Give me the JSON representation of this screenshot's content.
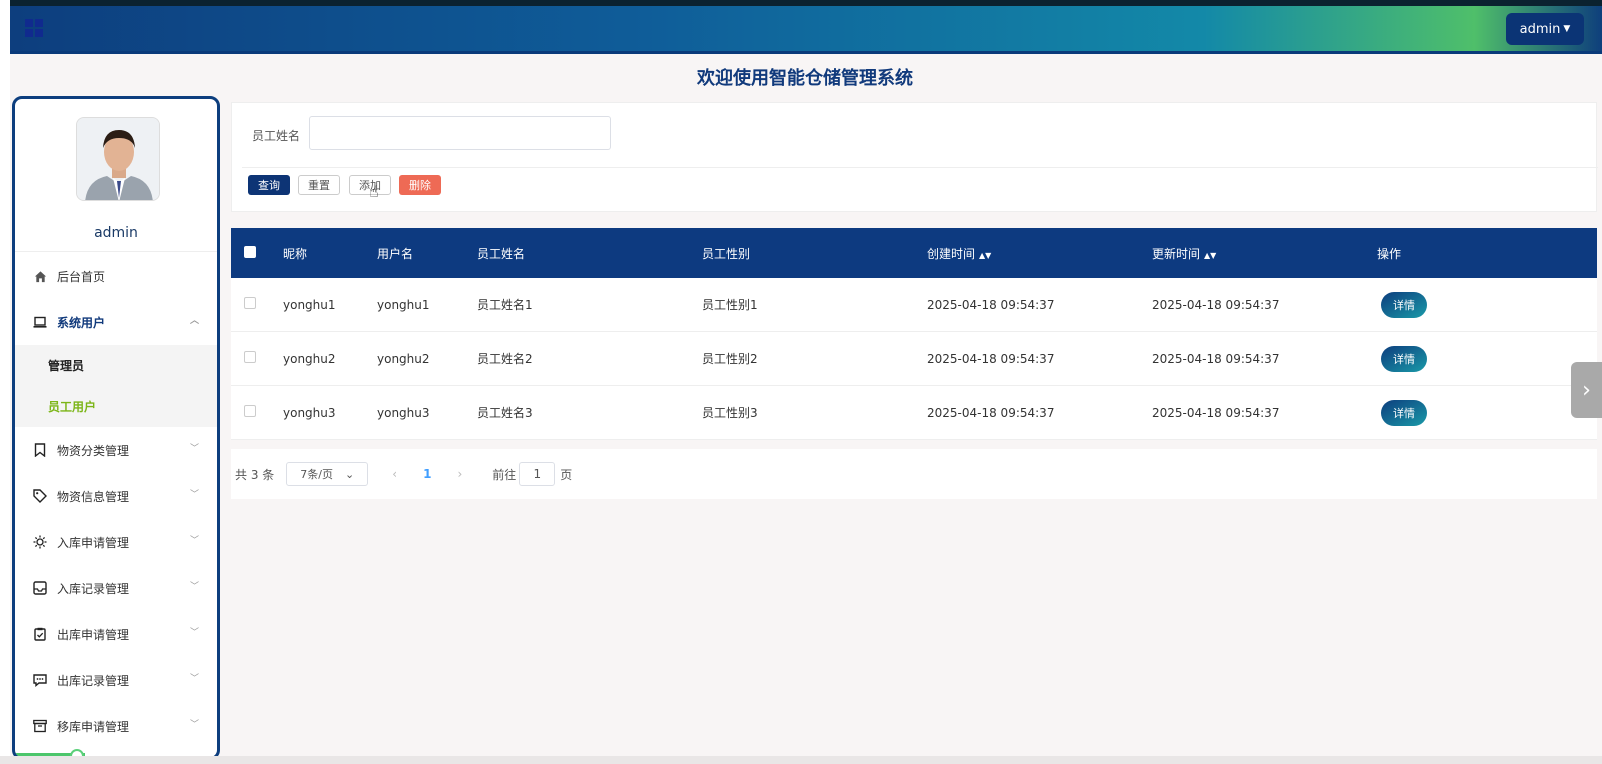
{
  "header": {
    "user_menu": "admin",
    "title": "欢迎使用智能仓储管理系统"
  },
  "sidebar": {
    "username": "admin",
    "items": [
      {
        "label": "后台首页",
        "icon": "home-icon"
      },
      {
        "label": "系统用户",
        "icon": "laptop-icon",
        "open": true,
        "children": [
          {
            "label": "管理员"
          },
          {
            "label": "员工用户",
            "active": true
          }
        ]
      },
      {
        "label": "物资分类管理",
        "icon": "bookmark-icon"
      },
      {
        "label": "物资信息管理",
        "icon": "tag-icon"
      },
      {
        "label": "入库申请管理",
        "icon": "sun-icon"
      },
      {
        "label": "入库记录管理",
        "icon": "inbox-icon"
      },
      {
        "label": "出库申请管理",
        "icon": "clipboard-check-icon"
      },
      {
        "label": "出库记录管理",
        "icon": "message-icon"
      },
      {
        "label": "移库申请管理",
        "icon": "archive-icon"
      }
    ]
  },
  "search": {
    "label": "员工姓名",
    "value": "",
    "buttons": {
      "query": "查询",
      "reset": "重置",
      "add": "添加",
      "delete": "删除"
    }
  },
  "table": {
    "columns": [
      "昵称",
      "用户名",
      "员工姓名",
      "员工性别",
      "创建时间",
      "更新时间",
      "操作"
    ],
    "rows": [
      {
        "nickname": "yonghu1",
        "username": "yonghu1",
        "name": "员工姓名1",
        "gender": "员工性别1",
        "created": "2025-04-18 09:54:37",
        "updated": "2025-04-18 09:54:37",
        "action": "详情"
      },
      {
        "nickname": "yonghu2",
        "username": "yonghu2",
        "name": "员工姓名2",
        "gender": "员工性别2",
        "created": "2025-04-18 09:54:37",
        "updated": "2025-04-18 09:54:37",
        "action": "详情"
      },
      {
        "nickname": "yonghu3",
        "username": "yonghu3",
        "name": "员工姓名3",
        "gender": "员工性别3",
        "created": "2025-04-18 09:54:37",
        "updated": "2025-04-18 09:54:37",
        "action": "详情"
      }
    ]
  },
  "pagination": {
    "total": "共 3 条",
    "page_size": "7条/页",
    "current_page": "1",
    "goto_prefix": "前往",
    "goto_value": "1",
    "goto_suffix": "页"
  },
  "colors": {
    "primary": "#0d3a80",
    "danger": "#ee6a55",
    "active_menu": "#7cb518"
  }
}
